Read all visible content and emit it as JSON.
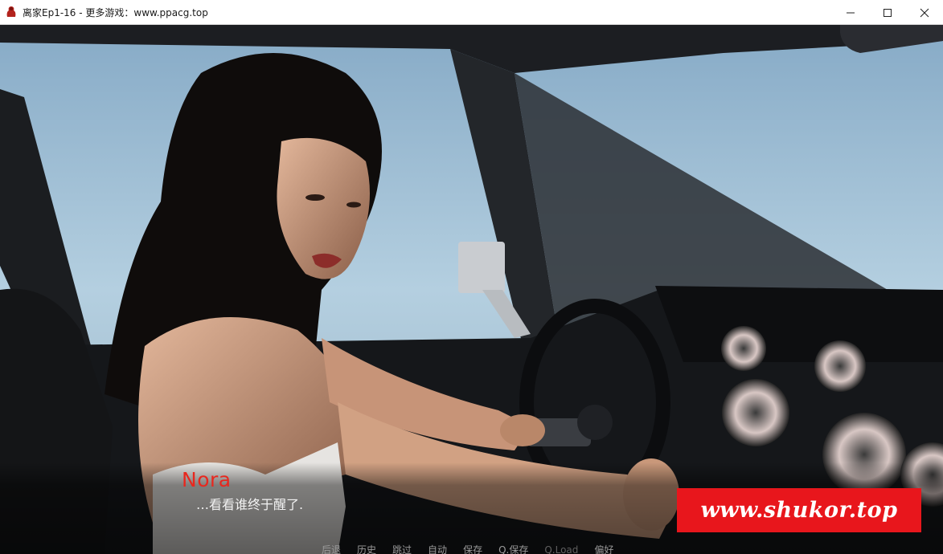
{
  "window": {
    "title": "离家Ep1-16 - 更多游戏：www.ppacg.top",
    "controls": {
      "minimize_icon": "minimize-icon",
      "maximize_icon": "maximize-icon",
      "close_icon": "close-icon"
    }
  },
  "dialogue": {
    "speaker": "Nora",
    "text": "…看看谁终于醒了.",
    "speaker_color": "#e8271e"
  },
  "watermark": {
    "text": "www.shukor.top",
    "background": "#e8161c"
  },
  "quick_menu": {
    "items": [
      {
        "label": "后退"
      },
      {
        "label": "历史"
      },
      {
        "label": "跳过"
      },
      {
        "label": "自动"
      },
      {
        "label": "保存"
      },
      {
        "label": "Q.保存"
      },
      {
        "label": "Q.Load"
      },
      {
        "label": "偏好"
      }
    ]
  }
}
